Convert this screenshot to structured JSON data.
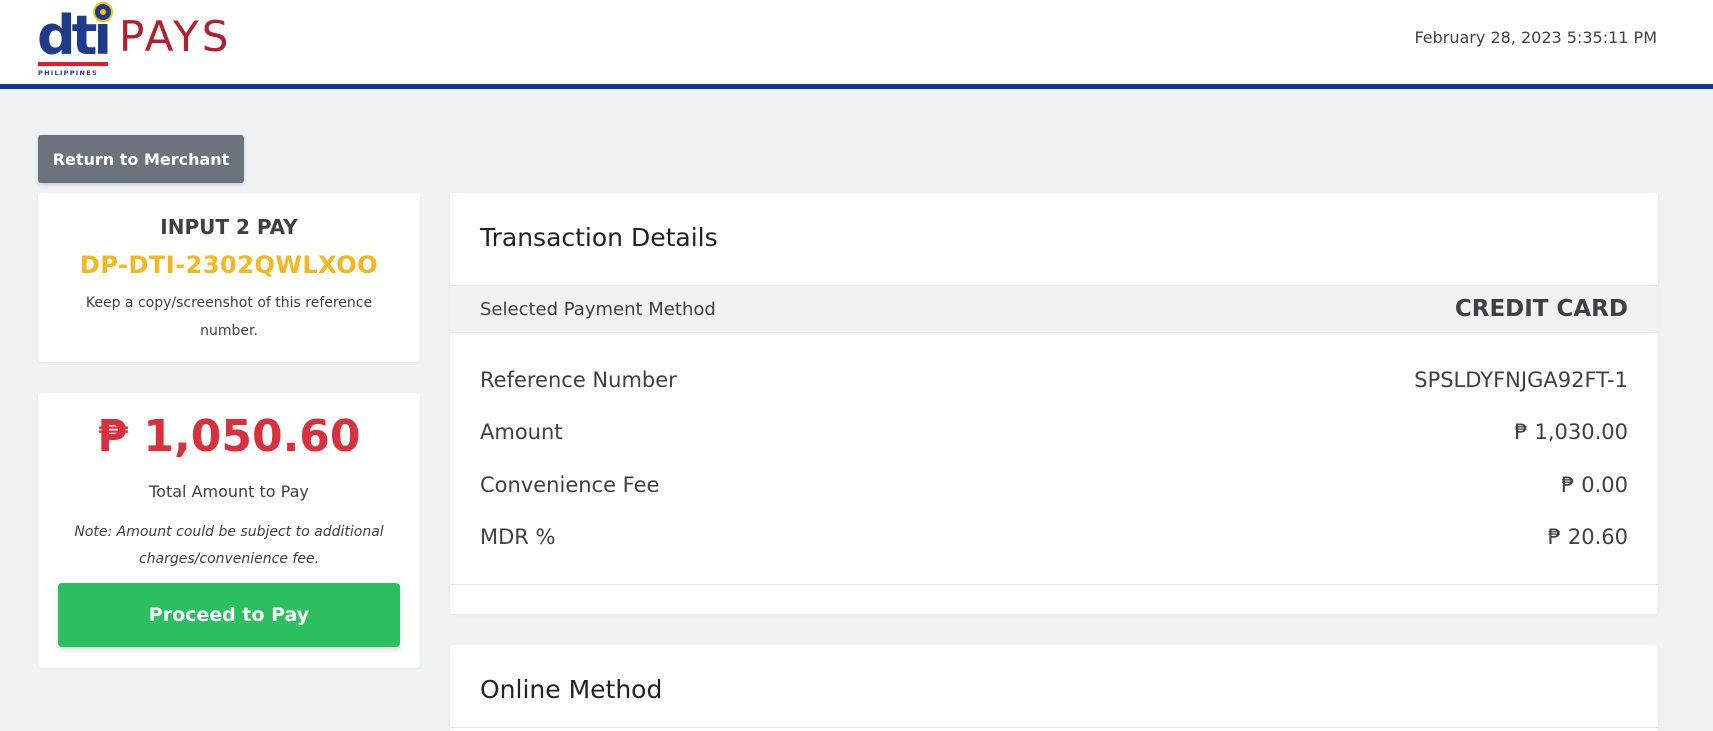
{
  "header": {
    "logo_text_dti": "dti",
    "logo_text_pays": "PAYS",
    "logo_subtext": "PHILIPPINES",
    "datetime": "February 28, 2023 5:35:11 PM",
    "brand_colors": {
      "navy": "#1e3a8a",
      "red": "#b0202f",
      "bar": "#0b3a94"
    }
  },
  "actions": {
    "return_label": "Return to Merchant",
    "pay_label": "Proceed to Pay"
  },
  "reference": {
    "title": "INPUT 2 PAY",
    "code": "DP-DTI-2302QWLXOO",
    "note": "Keep a copy/screenshot of this reference number."
  },
  "amount": {
    "total": "₱ 1,050.60",
    "label": "Total Amount to Pay",
    "note": "Note: Amount could be subject to additional charges/convenience fee."
  },
  "transaction": {
    "title": "Transaction Details",
    "payment_method_label": "Selected Payment Method",
    "payment_method_value": "CREDIT CARD",
    "rows": [
      {
        "label": "Reference Number",
        "value": "SPSLDYFNJGA92FT-1"
      },
      {
        "label": "Amount",
        "value": "₱ 1,030.00"
      },
      {
        "label": "Convenience Fee",
        "value": "₱ 0.00"
      },
      {
        "label": "MDR %",
        "value": "₱ 20.60"
      }
    ]
  },
  "online": {
    "title": "Online Method"
  }
}
